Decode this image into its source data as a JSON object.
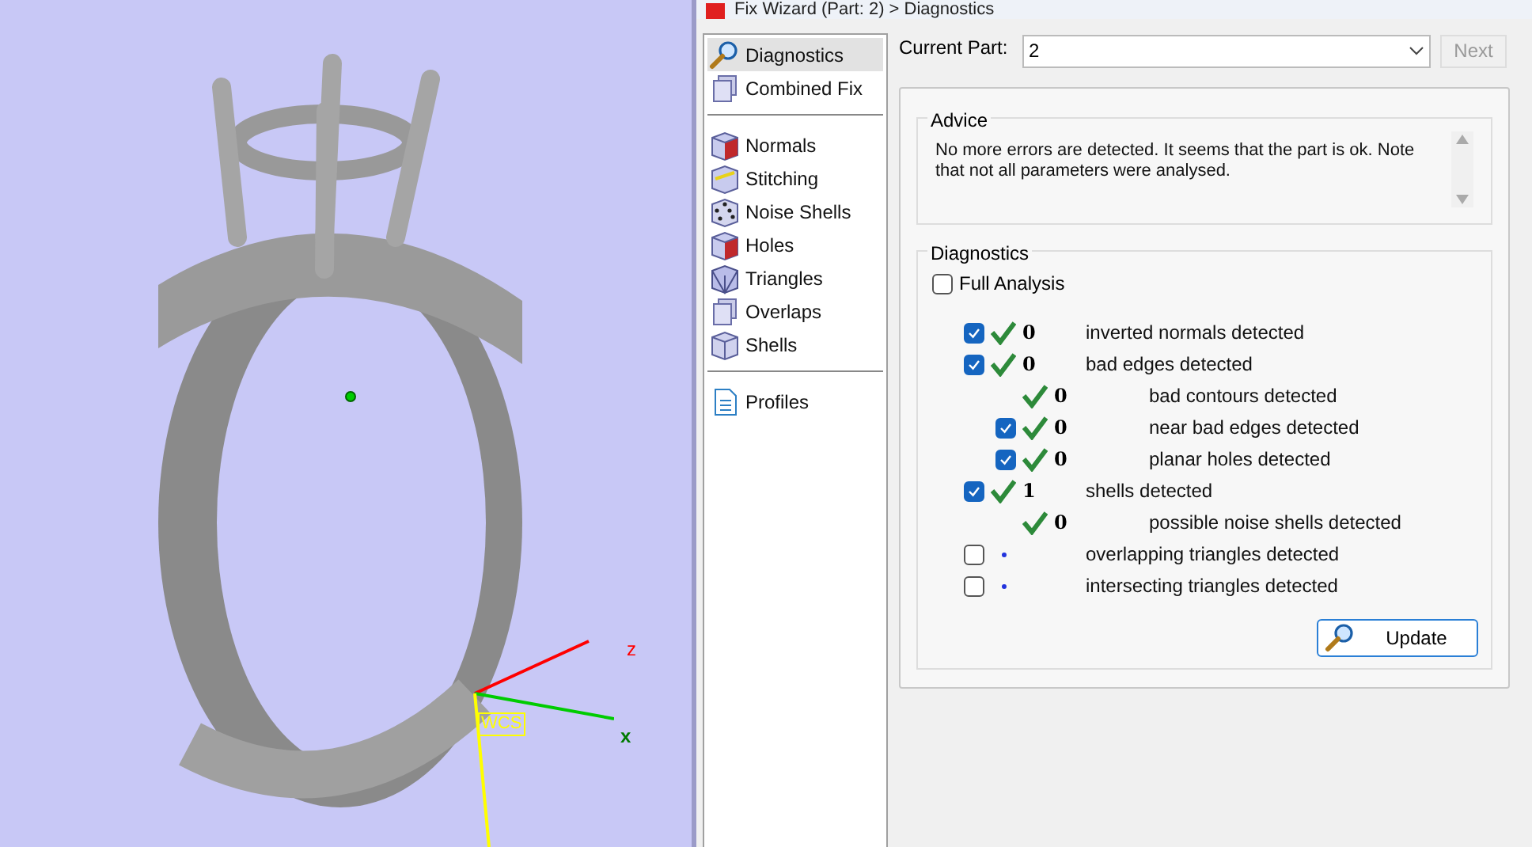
{
  "viewport": {
    "axes": [
      {
        "label": "z",
        "kind": "z"
      },
      {
        "label": "x",
        "kind": "x"
      }
    ],
    "frame_label": "WCS"
  },
  "window": {
    "title": "Fix Wizard (Part: 2) > Diagnostics"
  },
  "sidebar": {
    "groups": [
      [
        {
          "label": "Diagnostics",
          "kind": "magnifier",
          "selected": true
        },
        {
          "label": "Combined Fix",
          "kind": "stack",
          "selected": false
        }
      ],
      [
        {
          "label": "Normals",
          "kind": "normals",
          "selected": false
        },
        {
          "label": "Stitching",
          "kind": "stitch",
          "selected": false
        },
        {
          "label": "Noise Shells",
          "kind": "dice",
          "selected": false
        },
        {
          "label": "Holes",
          "kind": "normals",
          "selected": false
        },
        {
          "label": "Triangles",
          "kind": "triangles",
          "selected": false
        },
        {
          "label": "Overlaps",
          "kind": "stack",
          "selected": false
        },
        {
          "label": "Shells",
          "kind": "cube",
          "selected": false
        }
      ],
      [
        {
          "label": "Profiles",
          "kind": "doc",
          "selected": false
        }
      ]
    ]
  },
  "current_part": {
    "label": "Current Part:",
    "value": "2",
    "next": "Next",
    "next_disabled": true
  },
  "advice": {
    "title": "Advice",
    "text": "No more errors are detected. It seems that the part is ok. Note that not all parameters were analysed."
  },
  "diagnostics": {
    "title": "Diagnostics",
    "full_analysis": {
      "label": "Full Analysis",
      "checked": false
    },
    "rows": [
      {
        "checked": true,
        "passed": true,
        "count": "0",
        "label": "inverted normals detected"
      },
      {
        "checked": true,
        "passed": true,
        "count": "0",
        "label": "bad edges detected",
        "children": [
          {
            "passed": true,
            "count": "0",
            "label": "bad contours detected"
          },
          {
            "checked": true,
            "passed": true,
            "count": "0",
            "label": "near bad edges detected"
          },
          {
            "checked": true,
            "passed": true,
            "count": "0",
            "label": "planar holes detected"
          }
        ]
      },
      {
        "checked": true,
        "passed": true,
        "count": "1",
        "label": "shells detected",
        "children": [
          {
            "passed": true,
            "count": "0",
            "label": "possible noise shells detected"
          }
        ]
      },
      {
        "checked": false,
        "passed": false,
        "label": "overlapping triangles detected"
      },
      {
        "checked": false,
        "passed": false,
        "label": "intersecting triangles detected"
      }
    ],
    "update": "Update"
  }
}
